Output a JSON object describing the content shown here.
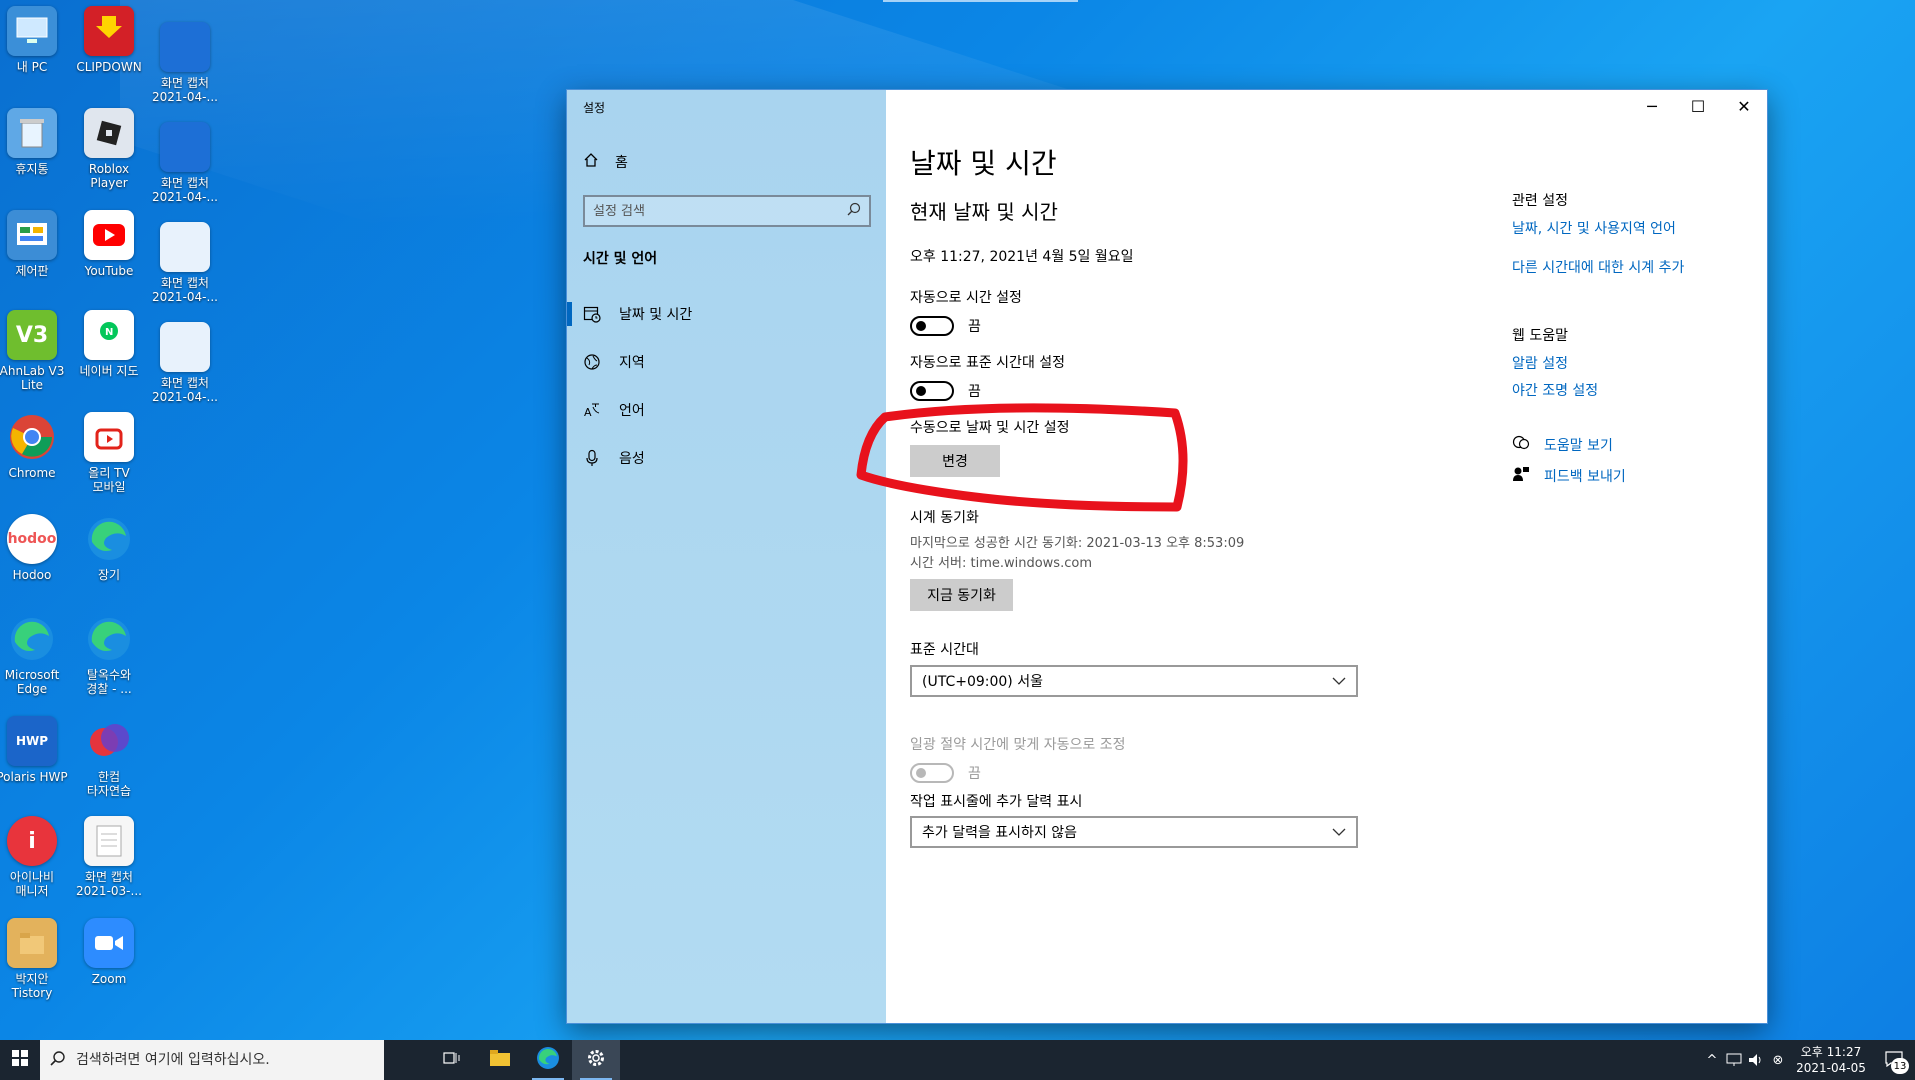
{
  "desktop": {
    "icons": [
      {
        "label": "내 PC"
      },
      {
        "label": "CLIPDOWN"
      },
      {
        "label": "화면 캡처\n2021-04-..."
      },
      {
        "label": "휴지통"
      },
      {
        "label": "Roblox\nPlayer"
      },
      {
        "label": "화면 캡처\n2021-04-..."
      },
      {
        "label": "제어판"
      },
      {
        "label": "YouTube"
      },
      {
        "label": "화면 캡처\n2021-04-..."
      },
      {
        "label": "AhnLab V3\nLite"
      },
      {
        "label": "네이버 지도"
      },
      {
        "label": "화면 캡처\n2021-04-..."
      },
      {
        "label": "Chrome"
      },
      {
        "label": "올리 TV\n모바일"
      },
      {
        "label": "Hodoo"
      },
      {
        "label": "장기"
      },
      {
        "label": "Microsoft\nEdge"
      },
      {
        "label": "탈옥수와\n경찰 - ..."
      },
      {
        "label": "Polaris HWP"
      },
      {
        "label": "한컴\n타자연습"
      },
      {
        "label": "아이나비\n매니저"
      },
      {
        "label": "화면 캡처\n2021-03-..."
      },
      {
        "label": "박지안\nTistory"
      },
      {
        "label": "Zoom"
      }
    ]
  },
  "window": {
    "title": "설정",
    "home_label": "홈",
    "search_placeholder": "설정 검색",
    "section": "시간 및 언어",
    "nav": [
      {
        "label": "날짜 및 시간"
      },
      {
        "label": "지역"
      },
      {
        "label": "언어"
      },
      {
        "label": "음성"
      }
    ],
    "page_title": "날짜 및 시간",
    "sub_title": "현재 날짜 및 시간",
    "now": "오후 11:27, 2021년 4월 5일 월요일",
    "auto_time_label": "자동으로 시간 설정",
    "auto_time_state": "끔",
    "auto_tz_label": "자동으로 표준 시간대 설정",
    "auto_tz_state": "끔",
    "manual_label": "수동으로 날짜 및 시간 설정",
    "change_button": "변경",
    "sync_label": "시계 동기화",
    "last_sync": "마지막으로 성공한 시간 동기화: 2021-03-13 오후 8:53:09",
    "time_server": "시간 서버: time.windows.com",
    "sync_button": "지금 동기화",
    "tz_label": "표준 시간대",
    "tz_value": "(UTC+09:00) 서울",
    "dst_label": "일광 절약 시간에 맞게 자동으로 조정",
    "dst_state": "끔",
    "calendar_label": "작업 표시줄에 추가 달력 표시",
    "calendar_value": "추가 달력을 표시하지 않음",
    "related_head": "관련 설정",
    "related_links": [
      "날짜, 시간 및 사용지역 언어",
      "다른 시간대에 대한 시계 추가"
    ],
    "help_head": "웹 도움말",
    "help_links": [
      "알람 설정",
      "야간 조명 설정"
    ],
    "help_view": "도움말 보기",
    "feedback": "피드백 보내기"
  },
  "taskbar": {
    "search_placeholder": "검색하려면 여기에 입력하십시오.",
    "clock_time": "오후 11:27",
    "clock_date": "2021-04-05",
    "notif_count": "13"
  },
  "colors": {
    "accent": "#0067c0",
    "annotation": "#e8121c",
    "sidebar": "#acd6f0"
  }
}
